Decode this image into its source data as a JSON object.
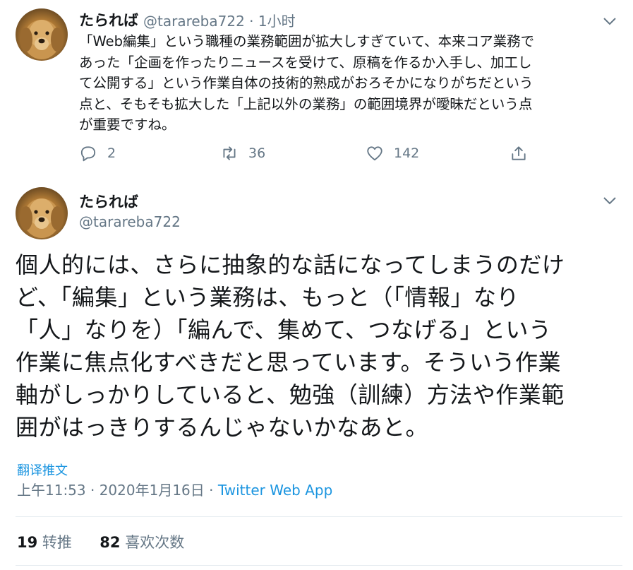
{
  "reply_tweet": {
    "display_name": "たられば",
    "handle": "@tarareba722",
    "separator": "·",
    "time": "1小时",
    "lines": [
      "「Web編集」という職種の業務範囲が拡大しすぎていて、本来コア業務で",
      "あった「企画を作ったりニュースを受けて、原稿を作るか入手し、加工し",
      "て公開する」という作業自体の技術的熟成がおろそかになりがちだという",
      "点と、そもそも拡大した「上記以外の業務」の範囲境界が曖昧だという点",
      "が重要ですね。"
    ],
    "reply_count": "2",
    "retweet_count": "36",
    "like_count": "142",
    "icons": [
      "reply-icon",
      "retweet-icon",
      "like-icon",
      "share-icon"
    ]
  },
  "main_tweet": {
    "display_name": "たられば",
    "handle": "@tarareba722",
    "lines": [
      "個人的には、さらに抽象的な話になってしまうのだけ",
      "ど、「編集」という業務は、もっと（「情報」なり",
      "「人」なりを）「編んで、集めて、つなげる」という",
      "作業に焦点化すべきだと思っています。そういう作業",
      "軸がしっかりしていると、勉強（訓練）方法や作業範",
      "囲がはっきりするんじゃないかなあと。"
    ],
    "translate_label": "翻译推文",
    "timestamp": "上午11:53 · 2020年1月16日 · ",
    "source": "Twitter Web App",
    "retweets_number": "19",
    "retweets_label": " 转推",
    "likes_number": "82",
    "likes_label": " 喜欢次数"
  },
  "colors": {
    "text": "#14171a",
    "secondary": "#657786",
    "accent": "#1b95e0",
    "divider": "#e6ecf0"
  }
}
